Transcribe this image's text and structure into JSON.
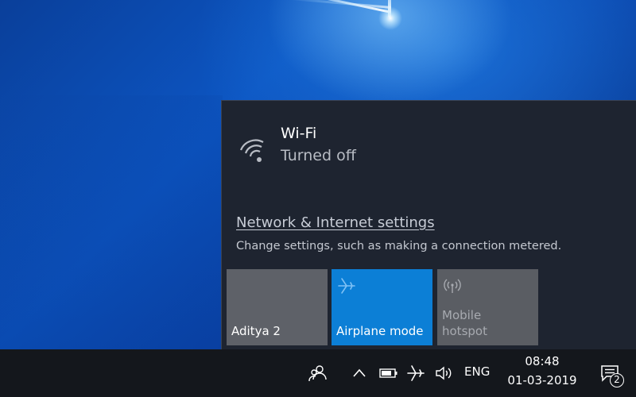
{
  "network_flyout": {
    "wifi": {
      "name": "Wi-Fi",
      "status": "Turned off",
      "icon": "wifi-icon"
    },
    "settings_link": "Network & Internet settings",
    "settings_description": "Change settings, such as making a connection metered.",
    "tiles": [
      {
        "label": "Aditya 2",
        "active": false,
        "icon": ""
      },
      {
        "label": "Airplane mode",
        "active": true,
        "icon": "airplane-icon"
      },
      {
        "label_line1": "Mobile",
        "label_line2": "hotspot",
        "active": false,
        "disabled": true,
        "icon": "hotspot-icon"
      }
    ]
  },
  "taskbar": {
    "icons": [
      "people-icon",
      "chevron-up-icon",
      "battery-icon",
      "airplane-icon",
      "volume-icon",
      "notification-icon"
    ],
    "language": "ENG",
    "time": "08:48",
    "date": "01-03-2019",
    "notification_count": "2"
  },
  "colors": {
    "accent": "#0c7fd6",
    "flyout_bg": "#1e2430",
    "tile_bg": "#5e6168",
    "taskbar_bg": "#14171c"
  }
}
